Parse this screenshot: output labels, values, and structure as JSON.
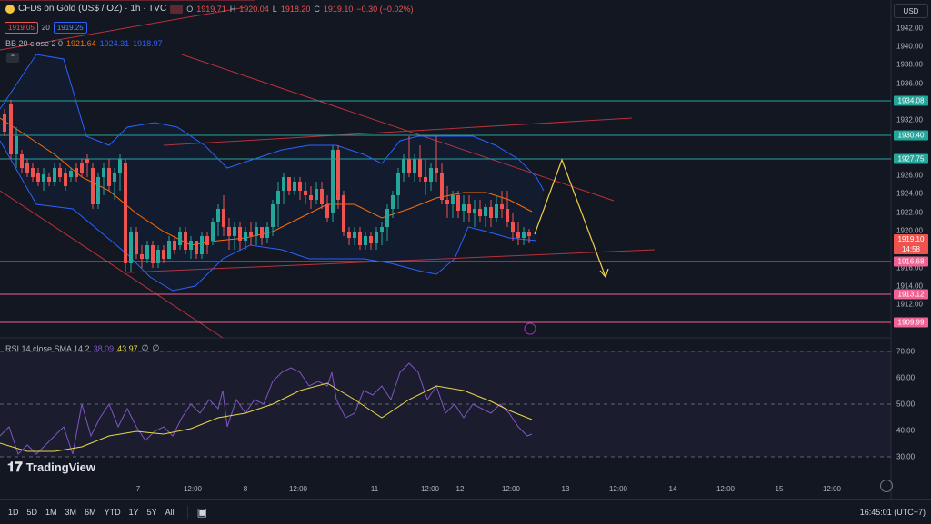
{
  "header": {
    "symbol": "CFDs on Gold (US$ / OZ) · 1h · TVC",
    "ohlc": {
      "o_label": "O",
      "o": "1919.71",
      "h_label": "H",
      "h": "1920.04",
      "l_label": "L",
      "l": "1918.20",
      "c_label": "C",
      "c": "1919.10",
      "change": "−0.30 (−0.02%)"
    },
    "bid": "1919.05",
    "spread": "20",
    "ask": "1919.25"
  },
  "bb_legend": {
    "label": "BB 20 close 2 0",
    "basis": "1921.64",
    "upper": "1924.31",
    "lower": "1918.97"
  },
  "rsi_legend": {
    "label": "RSI 14 close SMA 14 2",
    "rsi": "38.09",
    "sma": "43.97",
    "extra1": "∅",
    "extra2": "∅"
  },
  "currency": "USD",
  "price_axis": [
    "1942.00",
    "1940.00",
    "1938.00",
    "1936.00",
    "1932.00",
    "1928.00",
    "1926.00",
    "1924.00",
    "1922.00",
    "1920.00",
    "1916.00",
    "1914.00",
    "1912.00"
  ],
  "price_labels": {
    "l1934": "1934.08",
    "l1930": "1930.40",
    "l1927": "1927.75",
    "current": "1919.10",
    "countdown": "14:58",
    "l1916": "1916.68",
    "l1913": "1913.12",
    "l1909": "1909.99"
  },
  "rsi_axis": [
    "70.00",
    "60.00",
    "50.00",
    "40.00",
    "30.00"
  ],
  "time_axis": [
    "7",
    "12:00",
    "8",
    "12:00",
    "11",
    "12:00",
    "12",
    "12:00",
    "13",
    "12:00",
    "14",
    "12:00",
    "15",
    "12:00"
  ],
  "bottom": {
    "timeframes": [
      "1D",
      "5D",
      "1M",
      "3M",
      "6M",
      "YTD",
      "1Y",
      "5Y",
      "All"
    ],
    "clock": "16:45:01 (UTC+7)"
  },
  "watermark": "TradingView",
  "colors": {
    "bg": "#131722",
    "up": "#26a69a",
    "down": "#ef5350",
    "bb": "#2962ff",
    "basis": "#ff6d00",
    "hline": "#26a69a",
    "pinkline": "#f06292",
    "rsi": "#7e57c2",
    "rsi_sma": "#e8d84a",
    "arrow": "#f0d04a"
  }
}
